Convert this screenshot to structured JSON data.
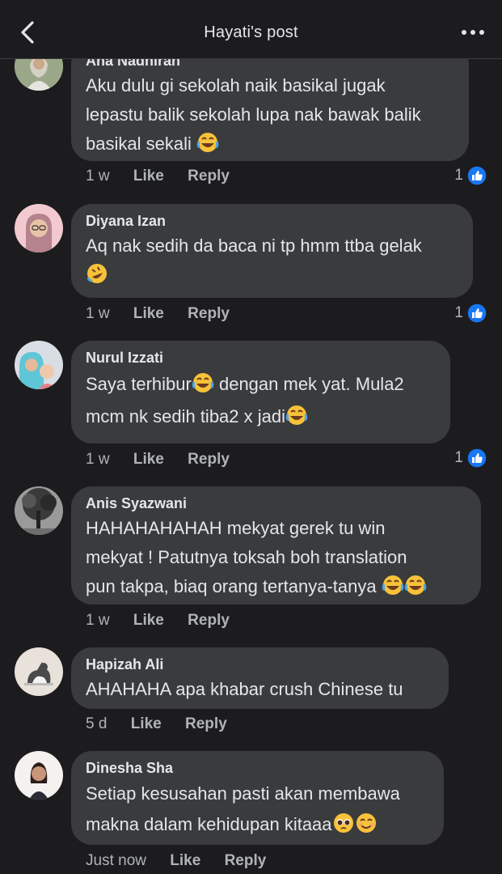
{
  "header": {
    "title": "Hayati's post",
    "back_icon": "chevron-left-icon",
    "more_icon": "more-horizontal-icon"
  },
  "action_labels": {
    "like": "Like",
    "reply": "Reply"
  },
  "colors": {
    "background": "#1c1c1e",
    "bubble": "#3a3b3c",
    "like_blue": "#1877f2",
    "muted": "#b0b3b8"
  },
  "comments": [
    {
      "name": "Ana Nadhiran",
      "lines": [
        "Aku dulu gi sekolah naik basikal jugak",
        "lepastu balik sekolah lupa nak bawak balik",
        "basikal sekali"
      ],
      "time": "1 w",
      "likes": "1"
    },
    {
      "name": "Diyana Izan",
      "lines": [
        "Aq nak sedih da baca ni tp hmm ttba gelak",
        ""
      ],
      "time": "1 w",
      "likes": "1"
    },
    {
      "name": "Nurul Izzati",
      "lines": [
        "Saya terhibur",
        " dengan mek yat. Mula2",
        "mcm nk sedih tiba2 x jadi"
      ],
      "time": "1 w",
      "likes": "1"
    },
    {
      "name": "Anis Syazwani",
      "lines": [
        "HAHAHAHAHAH mekyat gerek tu win",
        "mekyat ! Patutnya toksah boh translation",
        "pun takpa, biaq orang tertanya-tanya "
      ],
      "time": "1 w"
    },
    {
      "name": "Hapizah Ali",
      "lines": [
        "AHAHAHA apa khabar crush Chinese tu"
      ],
      "time": "5 d"
    },
    {
      "name": "Dinesha Sha",
      "lines": [
        "Setiap kesusahan pasti akan membawa",
        "makna dalam kehidupan kitaaa"
      ],
      "time": "Just now"
    }
  ]
}
